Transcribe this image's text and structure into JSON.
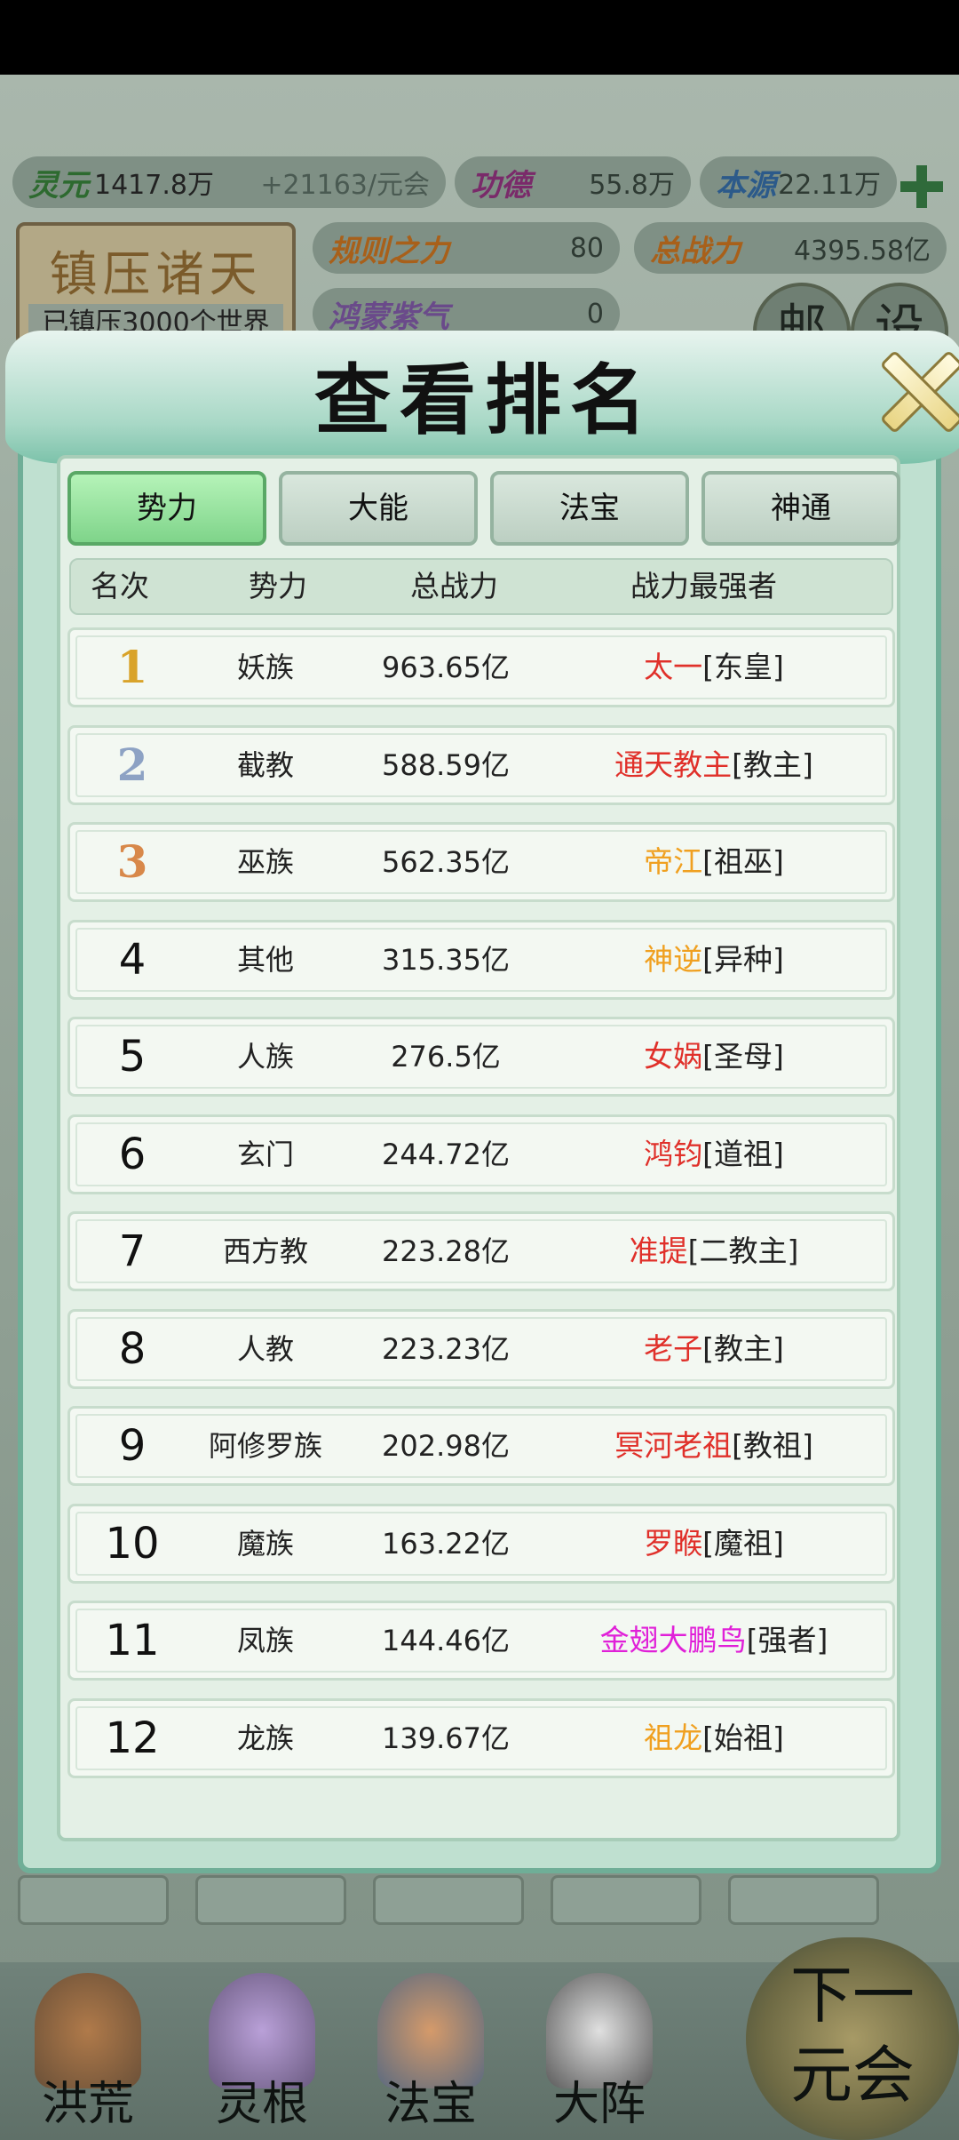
{
  "resources": {
    "lingyuan_label": "灵元",
    "lingyuan_value": "1417.8万",
    "lingyuan_rate": "+21163/元会",
    "gongde_label": "功德",
    "gongde_value": "55.8万",
    "benyuan_label": "本源",
    "benyuan_value": "22.11万",
    "guize_label": "规则之力",
    "guize_value": "80",
    "zongzhanli_label": "总战力",
    "zongzhanli_value": "4395.58亿",
    "hongmeng_label": "鸿蒙紫气",
    "hongmeng_value": "0"
  },
  "banner": {
    "title": "镇压诸天",
    "subtitle": "已镇压3000个世界"
  },
  "top_buttons": {
    "mail": "邮",
    "settings": "设"
  },
  "modal": {
    "title": "查看排名",
    "tabs": [
      "势力",
      "大能",
      "法宝",
      "神通"
    ],
    "active_tab": "势力",
    "headers": {
      "rank": "名次",
      "faction": "势力",
      "power": "总战力",
      "strongest": "战力最强者"
    },
    "rows": [
      {
        "rank": "1",
        "faction": "妖族",
        "power": "963.65亿",
        "name": "太一",
        "title": "[东皇]",
        "name_color": "#e0302a",
        "rank_color": "#d9a32a"
      },
      {
        "rank": "2",
        "faction": "截教",
        "power": "588.59亿",
        "name": "通天教主",
        "title": "[教主]",
        "name_color": "#e0302a",
        "rank_color": "#8da2c4"
      },
      {
        "rank": "3",
        "faction": "巫族",
        "power": "562.35亿",
        "name": "帝江",
        "title": "[祖巫]",
        "name_color": "#f0a020",
        "rank_color": "#d8884a"
      },
      {
        "rank": "4",
        "faction": "其他",
        "power": "315.35亿",
        "name": "神逆",
        "title": "[异种]",
        "name_color": "#f0a020",
        "rank_color": "#111111"
      },
      {
        "rank": "5",
        "faction": "人族",
        "power": "276.5亿",
        "name": "女娲",
        "title": "[圣母]",
        "name_color": "#e0302a",
        "rank_color": "#111111"
      },
      {
        "rank": "6",
        "faction": "玄门",
        "power": "244.72亿",
        "name": "鸿钧",
        "title": "[道祖]",
        "name_color": "#e0302a",
        "rank_color": "#111111"
      },
      {
        "rank": "7",
        "faction": "西方教",
        "power": "223.28亿",
        "name": "准提",
        "title": "[二教主]",
        "name_color": "#e0302a",
        "rank_color": "#111111"
      },
      {
        "rank": "8",
        "faction": "人教",
        "power": "223.23亿",
        "name": "老子",
        "title": "[教主]",
        "name_color": "#e0302a",
        "rank_color": "#111111"
      },
      {
        "rank": "9",
        "faction": "阿修罗族",
        "power": "202.98亿",
        "name": "冥河老祖",
        "title": "[教祖]",
        "name_color": "#e0302a",
        "rank_color": "#111111"
      },
      {
        "rank": "10",
        "faction": "魔族",
        "power": "163.22亿",
        "name": "罗睺",
        "title": "[魔祖]",
        "name_color": "#e0302a",
        "rank_color": "#111111"
      },
      {
        "rank": "11",
        "faction": "凤族",
        "power": "144.46亿",
        "name": "金翅大鹏鸟",
        "title": "[强者]",
        "name_color": "#e020d8",
        "rank_color": "#111111"
      },
      {
        "rank": "12",
        "faction": "龙族",
        "power": "139.67亿",
        "name": "祖龙",
        "title": "[始祖]",
        "name_color": "#f0a020",
        "rank_color": "#111111"
      }
    ]
  },
  "bottom_nav": {
    "items": [
      "洪荒",
      "灵根",
      "法宝",
      "大阵"
    ],
    "next_label": "下一元会"
  }
}
